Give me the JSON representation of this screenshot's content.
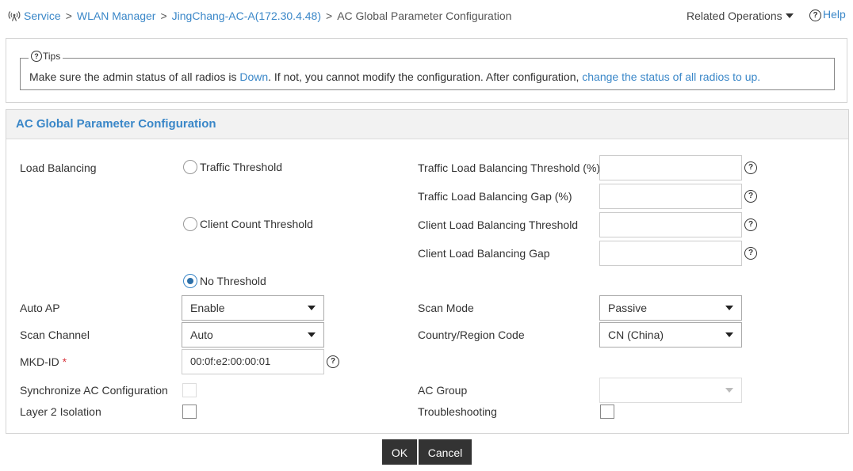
{
  "breadcrumb": {
    "items": [
      "Service",
      "WLAN Manager",
      "JingChang-AC-A(172.30.4.48)"
    ],
    "current": "AC Global Parameter Configuration",
    "separator": ">"
  },
  "header": {
    "related_operations": "Related Operations",
    "help": "Help"
  },
  "tips": {
    "title": "Tips",
    "text_1": "Make sure the admin status of all radios is ",
    "link_1": "Down",
    "text_2": ". If not, you cannot modify the configuration. After configuration, ",
    "link_2": "change the status of all radios to up."
  },
  "panel": {
    "title": "AC Global Parameter Configuration"
  },
  "form": {
    "load_balancing": {
      "label": "Load Balancing",
      "options": [
        "Traffic Threshold",
        "Client Count Threshold",
        "No Threshold"
      ],
      "selected": "No Threshold"
    },
    "traffic_threshold": {
      "label": "Traffic Load Balancing Threshold (%)",
      "value": ""
    },
    "traffic_gap": {
      "label": "Traffic Load Balancing Gap (%)",
      "value": ""
    },
    "client_threshold": {
      "label": "Client Load Balancing Threshold",
      "value": ""
    },
    "client_gap": {
      "label": "Client Load Balancing Gap",
      "value": ""
    },
    "auto_ap": {
      "label": "Auto AP",
      "value": "Enable"
    },
    "scan_mode": {
      "label": "Scan Mode",
      "value": "Passive"
    },
    "scan_channel": {
      "label": "Scan Channel",
      "value": "Auto"
    },
    "country_code": {
      "label": "Country/Region Code",
      "value": "CN (China)"
    },
    "mkd_id": {
      "label": "MKD-ID",
      "required_mark": "*",
      "value": "00:0f:e2:00:00:01"
    },
    "sync_ac": {
      "label": "Synchronize AC Configuration",
      "checked": false,
      "disabled": true
    },
    "ac_group": {
      "label": "AC Group",
      "value": "",
      "disabled": true
    },
    "layer2_isolation": {
      "label": "Layer 2 Isolation",
      "checked": false
    },
    "troubleshooting": {
      "label": "Troubleshooting",
      "checked": false
    }
  },
  "buttons": {
    "ok": "OK",
    "cancel": "Cancel"
  },
  "help_icon_glyph": "?",
  "colors": {
    "link": "#3a87c8",
    "title": "#3a87c8",
    "button_bg": "#333333",
    "required": "#d9363e"
  }
}
